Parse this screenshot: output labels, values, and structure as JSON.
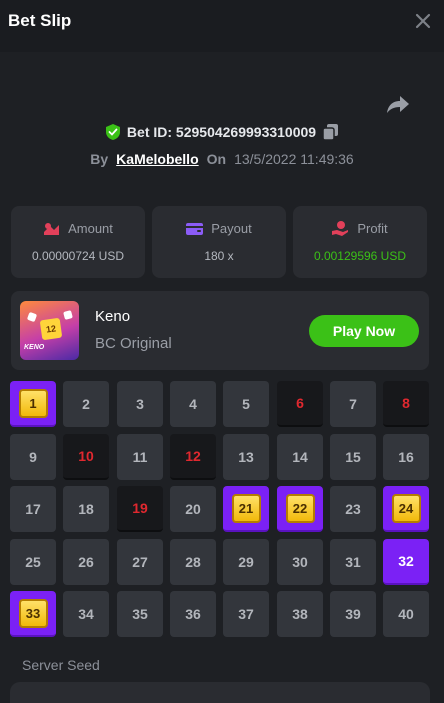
{
  "header": {
    "title": "Bet Slip",
    "close_icon": "close-icon"
  },
  "bet": {
    "id_label": "Bet ID: 529504269993310009",
    "by_label": "By",
    "username": "KaMelobello",
    "on_label": "On",
    "date": "13/5/2022 11:49:36"
  },
  "stats": [
    {
      "label": "Amount",
      "value": "0.00000724 USD",
      "icon": "coins-icon",
      "color": "#e2405a"
    },
    {
      "label": "Payout",
      "value": "180 x",
      "icon": "wallet-icon",
      "color": "#8b5cf6"
    },
    {
      "label": "Profit",
      "value": "0.00129596 USD",
      "icon": "profit-hand-icon",
      "color": "#e2405a",
      "value_color": "#3bc117"
    }
  ],
  "game": {
    "name": "Keno",
    "subtitle": "BC Original",
    "play_label": "Play Now",
    "thumb_text": "KENO"
  },
  "grid": {
    "cells": [
      {
        "n": "1",
        "state": "hit"
      },
      {
        "n": "2",
        "state": "norm"
      },
      {
        "n": "3",
        "state": "norm"
      },
      {
        "n": "4",
        "state": "norm"
      },
      {
        "n": "5",
        "state": "norm"
      },
      {
        "n": "6",
        "state": "dark"
      },
      {
        "n": "7",
        "state": "norm"
      },
      {
        "n": "8",
        "state": "dark"
      },
      {
        "n": "9",
        "state": "norm"
      },
      {
        "n": "10",
        "state": "dark"
      },
      {
        "n": "11",
        "state": "norm"
      },
      {
        "n": "12",
        "state": "dark"
      },
      {
        "n": "13",
        "state": "norm"
      },
      {
        "n": "14",
        "state": "norm"
      },
      {
        "n": "15",
        "state": "norm"
      },
      {
        "n": "16",
        "state": "norm"
      },
      {
        "n": "17",
        "state": "norm"
      },
      {
        "n": "18",
        "state": "norm"
      },
      {
        "n": "19",
        "state": "dark"
      },
      {
        "n": "20",
        "state": "norm"
      },
      {
        "n": "21",
        "state": "hit"
      },
      {
        "n": "22",
        "state": "hit"
      },
      {
        "n": "23",
        "state": "norm"
      },
      {
        "n": "24",
        "state": "hit"
      },
      {
        "n": "25",
        "state": "norm"
      },
      {
        "n": "26",
        "state": "norm"
      },
      {
        "n": "27",
        "state": "norm"
      },
      {
        "n": "28",
        "state": "norm"
      },
      {
        "n": "29",
        "state": "norm"
      },
      {
        "n": "30",
        "state": "norm"
      },
      {
        "n": "31",
        "state": "norm"
      },
      {
        "n": "32",
        "state": "sel"
      },
      {
        "n": "33",
        "state": "hit"
      },
      {
        "n": "34",
        "state": "norm"
      },
      {
        "n": "35",
        "state": "norm"
      },
      {
        "n": "36",
        "state": "norm"
      },
      {
        "n": "37",
        "state": "norm"
      },
      {
        "n": "38",
        "state": "norm"
      },
      {
        "n": "39",
        "state": "norm"
      },
      {
        "n": "40",
        "state": "norm"
      }
    ]
  },
  "server_seed": {
    "label": "Server Seed"
  }
}
